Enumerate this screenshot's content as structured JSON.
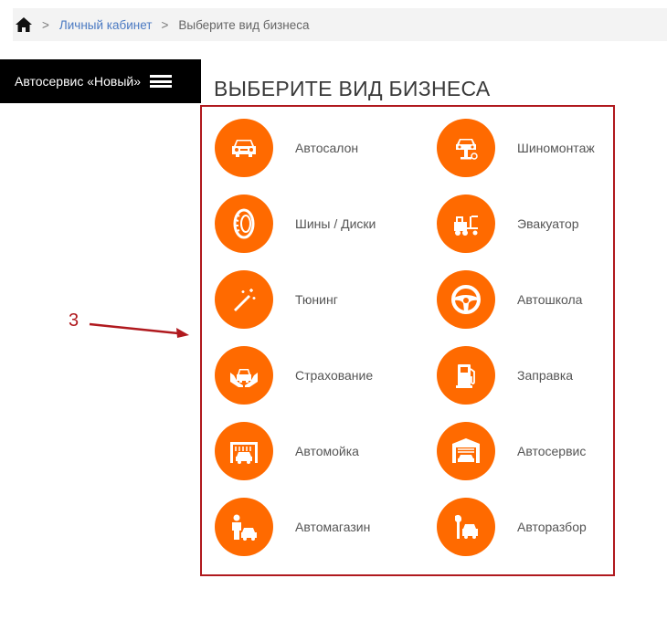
{
  "breadcrumb": {
    "home_icon": "home-icon",
    "sep1": ">",
    "link": "Личный кабинет",
    "sep2": ">",
    "current": "Выберите вид бизнеса"
  },
  "sidebar": {
    "title": "Автосервис «Новый»",
    "menu_icon": "hamburger-icon"
  },
  "main": {
    "title": "ВЫБЕРИТЕ ВИД БИЗНЕСА",
    "accent_color": "#ff6a00",
    "items": [
      {
        "label": "Автосалон",
        "icon": "car-front-icon"
      },
      {
        "label": "Шиномонтаж",
        "icon": "car-lift-icon"
      },
      {
        "label": "Шины / Диски",
        "icon": "tire-icon"
      },
      {
        "label": "Эвакуатор",
        "icon": "tow-truck-icon"
      },
      {
        "label": "Тюнинг",
        "icon": "magic-wand-icon"
      },
      {
        "label": "Автошкола",
        "icon": "steering-wheel-icon"
      },
      {
        "label": "Страхование",
        "icon": "insured-car-icon"
      },
      {
        "label": "Заправка",
        "icon": "fuel-pump-icon"
      },
      {
        "label": "Автомойка",
        "icon": "car-wash-icon"
      },
      {
        "label": "Автосервис",
        "icon": "garage-icon"
      },
      {
        "label": "Автомагазин",
        "icon": "car-shop-icon"
      },
      {
        "label": "Авторазбор",
        "icon": "wrench-car-icon"
      }
    ]
  },
  "annotation": {
    "label": "3",
    "color": "#b0191e"
  }
}
